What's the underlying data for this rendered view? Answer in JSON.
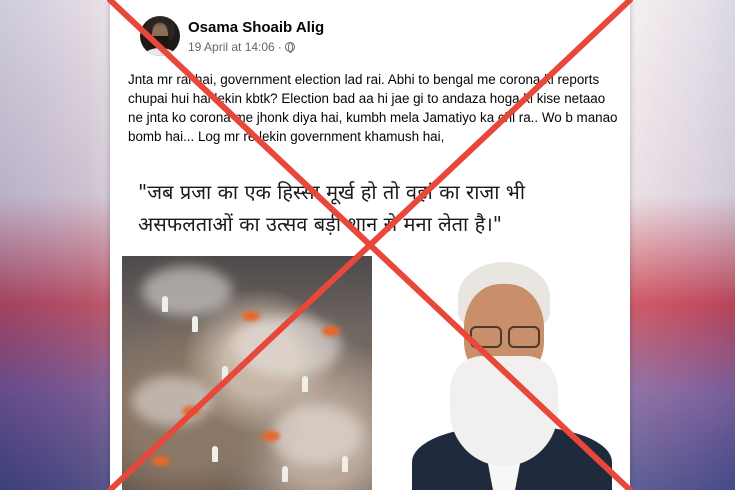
{
  "post": {
    "author": "Osama Shoaib Alig",
    "timestamp": "19 April at 14:06",
    "separator": "·",
    "text": "Jnta mr rai hai, government election lad rai. Abhi to bengal me corona ki reports chupai hui hai lekin kbtk? Election bad aa hi jae gi to andaza hoga ki kise netaao ne jnta ko corona me jhonk diya hai, kumbh mela Jamatiyo ka chl ra.. Wo b manao bomb hai... Log mr re lekin government khamush hai,",
    "quote": "\"जब प्रजा का एक हिस्सा मूर्ख हो तो वहां का राजा भी असफलताओं का उत्सव बड़ी शान से मना लेता है।\""
  },
  "icons": {
    "privacy": "globe-icon",
    "overlay": "red-cross-overlay"
  },
  "colors": {
    "cross": "#e8473c",
    "author": "#050505",
    "meta": "#65676b"
  }
}
